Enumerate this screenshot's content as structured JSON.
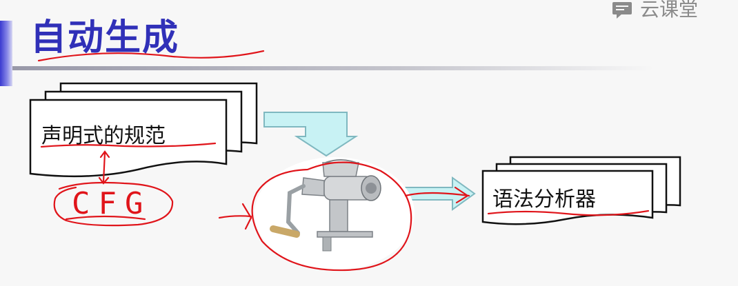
{
  "slide": {
    "title": "自动生成"
  },
  "brand": {
    "label": "云课堂",
    "icon": "chat-bubble-icon"
  },
  "diagram": {
    "spec_doc": "声明式的规范",
    "cfg_note": "CFG",
    "output_doc": "语法分析器",
    "machine_icon": "meat-grinder-icon"
  },
  "colors": {
    "title": "#3030b8",
    "annotation": "#e0141a",
    "arrow_fill": "#c8f2f4",
    "arrow_stroke": "#7fb8c0"
  }
}
